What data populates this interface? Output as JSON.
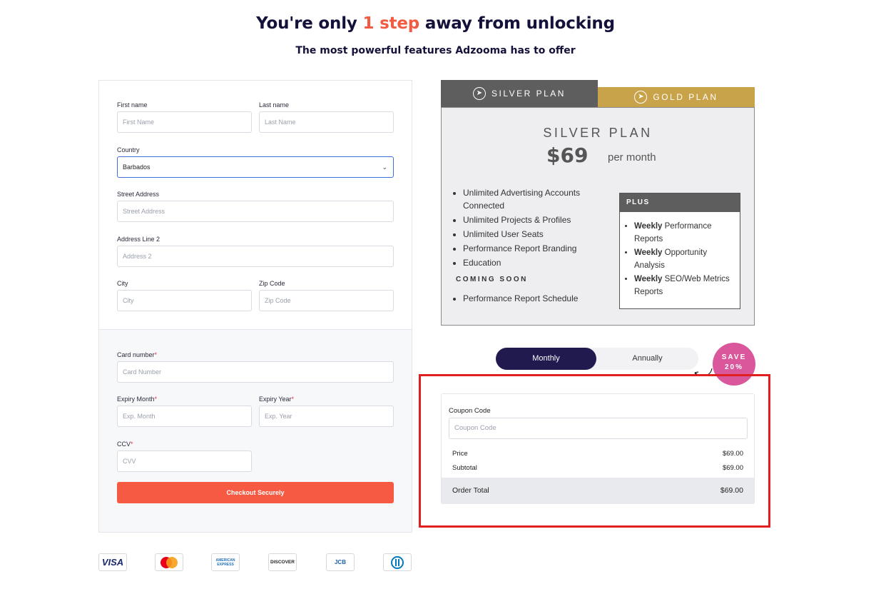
{
  "header": {
    "title_prefix": "You're only",
    "title_accent": "1 step",
    "title_suffix": "away from unlocking",
    "subtitle": "The most powerful features Adzooma has to offer"
  },
  "form": {
    "first_name": {
      "label": "First name",
      "placeholder": "First Name"
    },
    "last_name": {
      "label": "Last name",
      "placeholder": "Last Name"
    },
    "country": {
      "label": "Country",
      "value": "Barbados"
    },
    "street": {
      "label": "Street Address",
      "placeholder": "Street Address"
    },
    "address2": {
      "label": "Address Line 2",
      "placeholder": "Address 2"
    },
    "city": {
      "label": "City",
      "placeholder": "City"
    },
    "zip": {
      "label": "Zip Code",
      "placeholder": "Zip Code"
    },
    "card_number": {
      "label": "Card number",
      "placeholder": "Card Number"
    },
    "expiry_month": {
      "label": "Expiry Month",
      "placeholder": "Exp. Month"
    },
    "expiry_year": {
      "label": "Expiry Year",
      "placeholder": "Exp. Year"
    },
    "ccv": {
      "label": "CCV",
      "placeholder": "CVV"
    },
    "required_mark": "*",
    "checkout_label": "Checkout Securely"
  },
  "card_logos": [
    "VISA",
    "mastercard",
    "AMERICAN EXPRESS",
    "DISCOVER",
    "JCB",
    "Diners"
  ],
  "plans": {
    "tabs": [
      {
        "label": "SILVER PLAN",
        "color": "#5e5e5e"
      },
      {
        "label": "GOLD PLAN",
        "color": "#c9a34a"
      }
    ],
    "selected": {
      "title": "SILVER PLAN",
      "price": "$69",
      "period": "per month",
      "features": [
        "Unlimited Advertising Accounts Connected",
        "Unlimited Projects & Profiles",
        "Unlimited User Seats",
        "Performance Report Branding",
        "Education"
      ],
      "coming_soon_heading": "COMING SOON",
      "coming_soon": [
        "Performance Report Schedule"
      ],
      "plus_heading": "PLUS",
      "plus": [
        {
          "bold": "Weekly",
          "rest": " Performance Reports"
        },
        {
          "bold": "Weekly",
          "rest": " Opportunity Analysis"
        },
        {
          "bold": "Weekly",
          "rest": " SEO/Web Metrics Reports"
        }
      ]
    }
  },
  "billing_toggle": {
    "monthly": "Monthly",
    "annually": "Annually",
    "active": "Monthly",
    "save_line1": "SAVE",
    "save_line2": "20%"
  },
  "summary": {
    "coupon_label": "Coupon Code",
    "coupon_placeholder": "Coupon Code",
    "price_label": "Price",
    "price_value": "$69.00",
    "subtotal_label": "Subtotal",
    "subtotal_value": "$69.00",
    "total_label": "Order Total",
    "total_value": "$69.00"
  },
  "colors": {
    "accent": "#f25b43",
    "button": "#f75a43",
    "navy": "#201a4e",
    "badge": "#d9579a",
    "highlight": "#e02020"
  }
}
